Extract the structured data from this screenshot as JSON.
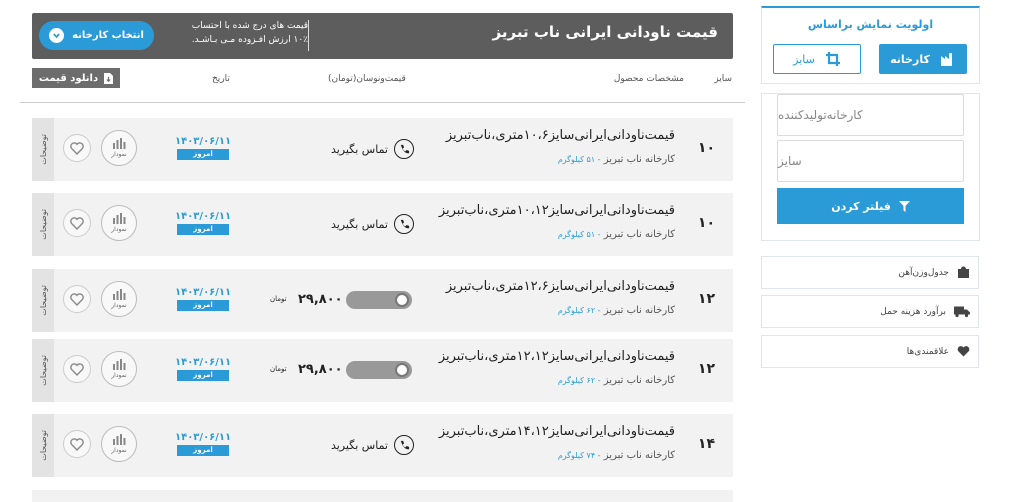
{
  "header": {
    "title": "قیمت ناودانی ایرانی ناب تبریز",
    "note_line1": "قیمت های درج شده با احتساب",
    "note_line2": "۱۰٪ ارزش افـزوده مـی بـاشـد.",
    "choose_factory": "انتخاب کارخانه"
  },
  "columns": {
    "size": "سایز",
    "specs": "مشخصات محصول",
    "price": "قیمت‌ونوسان(تومان)",
    "date": "تاریخ",
    "download": "دانلود قیمت"
  },
  "sidebar": {
    "priority_title": "اولویت نمایش براساس",
    "factory_btn": "کارخانه",
    "size_btn": "سایز",
    "maker_placeholder": "کارخانه‌تولیدکننده",
    "size_placeholder": "سایز",
    "filter_btn": "فیلتر کردن",
    "links": [
      {
        "label": "جدول‌وزن‌آهن",
        "icon": "weight-icon"
      },
      {
        "label": "برآورد هزینه حمل",
        "icon": "truck-icon"
      },
      {
        "label": "علاقمندی‌ها",
        "icon": "heart-icon"
      }
    ]
  },
  "rows": [
    {
      "size": "۱۰",
      "title": "قیمت‌ناودانی‌ایرانی‌سایز۱۰،۶متری،ناب‌تبریز",
      "maker": "کارخانه ناب تبریز",
      "weight": "- ۵۱ کیلوگرم",
      "contact": "تماس بگیرید",
      "price": null,
      "unit": null,
      "date": "۱۴۰۳/۰۶/۱۱",
      "today": "امروز",
      "chart": "نمودار",
      "desc": "توضیحات"
    },
    {
      "size": "۱۰",
      "title": "قیمت‌ناودانی‌ایرانی‌سایز۱۰،۱۲متری،ناب‌تبریز",
      "maker": "کارخانه ناب تبریز",
      "weight": "- ۵۱ کیلوگرم",
      "contact": "تماس بگیرید",
      "price": null,
      "unit": null,
      "date": "۱۴۰۳/۰۶/۱۱",
      "today": "امروز",
      "chart": "نمودار",
      "desc": "توضیحات"
    },
    {
      "size": "۱۲",
      "title": "قیمت‌ناودانی‌ایرانی‌سایز۱۲،۶متری،ناب‌تبریز",
      "maker": "کارخانه ناب تبریز",
      "weight": "- ۶۲ کیلوگرم",
      "contact": null,
      "price": "۲۹,۸۰۰",
      "unit": "تومان",
      "date": "۱۴۰۳/۰۶/۱۱",
      "today": "امروز",
      "chart": "نمودار",
      "desc": "توضیحات"
    },
    {
      "size": "۱۲",
      "title": "قیمت‌ناودانی‌ایرانی‌سایز۱۲،۱۲متری،ناب‌تبریز",
      "maker": "کارخانه ناب تبریز",
      "weight": "- ۶۲ کیلوگرم",
      "contact": null,
      "price": "۲۹,۸۰۰",
      "unit": "تومان",
      "date": "۱۴۰۳/۰۶/۱۱",
      "today": "امروز",
      "chart": "نمودار",
      "desc": "توضیحات"
    },
    {
      "size": "۱۴",
      "title": "قیمت‌ناودانی‌ایرانی‌سایز۱۴،۱۲متری،ناب‌تبریز",
      "maker": "کارخانه ناب تبریز",
      "weight": "- ۷۴ کیلوگرم",
      "contact": "تماس بگیرید",
      "price": null,
      "unit": null,
      "date": "۱۴۰۳/۰۶/۱۱",
      "today": "امروز",
      "chart": "نمودار",
      "desc": "توضیحات"
    }
  ]
}
